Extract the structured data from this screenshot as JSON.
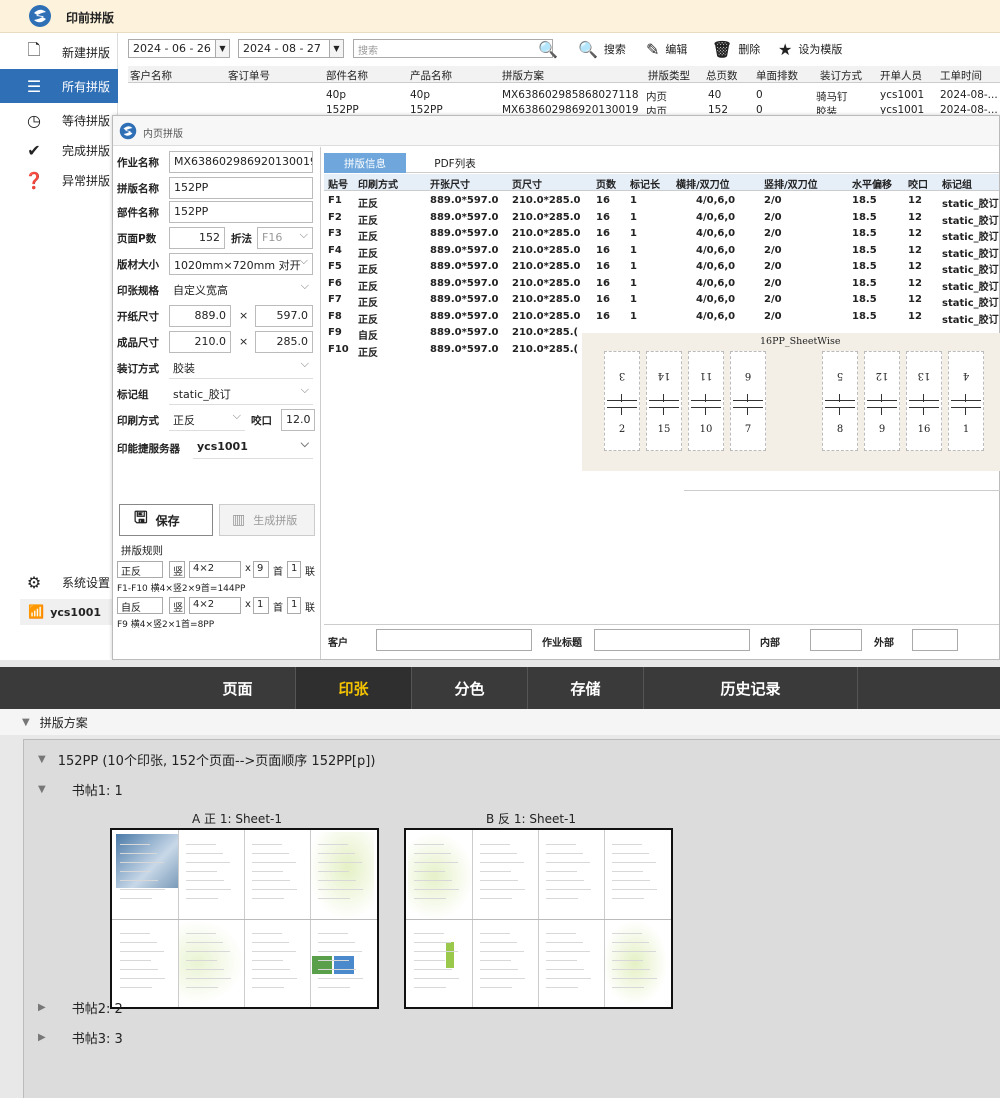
{
  "app": {
    "title": "印前拼版",
    "sidebar": [
      {
        "label": "新建拼版",
        "icon": "new-file-icon",
        "glyph": "🗋"
      },
      {
        "label": "所有拼版",
        "icon": "list-icon",
        "glyph": "☰"
      },
      {
        "label": "等待拼版",
        "icon": "clock-icon",
        "glyph": "◷"
      },
      {
        "label": "完成拼版",
        "icon": "check-icon",
        "glyph": "✔"
      },
      {
        "label": "异常拼版",
        "icon": "question-icon",
        "glyph": "❓"
      }
    ],
    "settings_label": "系统设置",
    "user": "ycs1001"
  },
  "toolbar": {
    "date_from": "2024 - 06 - 26",
    "date_to": "2024 - 08 - 27",
    "search_placeholder": "搜索",
    "search_label": "搜索",
    "edit_label": "编辑",
    "delete_label": "删除",
    "template_label": "设为模版"
  },
  "job_table": {
    "headers": [
      "客户名称",
      "客订单号",
      "部件名称",
      "产品名称",
      "拼版方案",
      "拼版类型",
      "总页数",
      "单面排数",
      "装订方式",
      "开单人员",
      "工单时间"
    ],
    "rows": [
      [
        "",
        "",
        "40p",
        "40p",
        "MX638602985868027118",
        "内页",
        "40",
        "0",
        "骑马钉",
        "ycs1001",
        "2024-08-..."
      ],
      [
        "",
        "",
        "152PP",
        "152PP",
        "MX638602986920130019",
        "内页",
        "152",
        "0",
        "胶装",
        "ycs1001",
        "2024-08-..."
      ]
    ]
  },
  "dialog": {
    "title": "内页拼版",
    "form": {
      "job_name_label": "作业名称",
      "job_name": "MX638602986920130019",
      "imp_name_label": "拼版名称",
      "imp_name": "152PP",
      "part_name_label": "部件名称",
      "part_name": "152PP",
      "pages_label": "页面P数",
      "pages": "152",
      "fold_label": "折法",
      "fold": "F16",
      "plate_label": "版材大小",
      "plate": "1020mm×720mm 对开",
      "paper_spec_label": "印张规格",
      "paper_spec": "自定义宽高",
      "open_size_label": "开纸尺寸",
      "open_w": "889.0",
      "open_h": "597.0",
      "final_size_label": "成品尺寸",
      "final_w": "210.0",
      "final_h": "285.0",
      "times": "×",
      "binding_label": "装订方式",
      "binding": "胶装",
      "mark_group_label": "标记组",
      "mark_group": "static_胶订",
      "print_mode_label": "印刷方式",
      "print_mode": "正反",
      "bite_label": "咬口",
      "bite": "12.0",
      "server_label": "印能捷服务器",
      "server": "ycs1001",
      "save_label": "保存",
      "generate_label": "生成拼版",
      "rules_label": "拼版规则",
      "rule1": {
        "mode": "正反",
        "orient": "竖",
        "grid": "4×2",
        "x": "x",
        "count": "9",
        "unit": "首",
        "joint": "1",
        "joint_unit": "联",
        "note": "F1-F10  横4×竖2×9首=144PP"
      },
      "rule2": {
        "mode": "自反",
        "orient": "竖",
        "grid": "4×2",
        "x": "x",
        "count": "1",
        "unit": "首",
        "joint": "1",
        "joint_unit": "联",
        "note": "F9  横4×竖2×1首=8PP"
      }
    },
    "tabs": [
      "拼版信息",
      "PDF列表"
    ],
    "sheet_headers": [
      "贴号",
      "印刷方式",
      "开张尺寸",
      "页尺寸",
      "页数",
      "标记长",
      "横排/双刀位",
      "竖排/双刀位",
      "水平偏移",
      "咬口",
      "标记组"
    ],
    "sheets": [
      [
        "F1",
        "正反",
        "889.0*597.0",
        "210.0*285.0",
        "16",
        "1",
        "4/0,6,0",
        "2/0",
        "18.5",
        "12",
        "static_胶订"
      ],
      [
        "F2",
        "正反",
        "889.0*597.0",
        "210.0*285.0",
        "16",
        "1",
        "4/0,6,0",
        "2/0",
        "18.5",
        "12",
        "static_胶订"
      ],
      [
        "F3",
        "正反",
        "889.0*597.0",
        "210.0*285.0",
        "16",
        "1",
        "4/0,6,0",
        "2/0",
        "18.5",
        "12",
        "static_胶订"
      ],
      [
        "F4",
        "正反",
        "889.0*597.0",
        "210.0*285.0",
        "16",
        "1",
        "4/0,6,0",
        "2/0",
        "18.5",
        "12",
        "static_胶订"
      ],
      [
        "F5",
        "正反",
        "889.0*597.0",
        "210.0*285.0",
        "16",
        "1",
        "4/0,6,0",
        "2/0",
        "18.5",
        "12",
        "static_胶订"
      ],
      [
        "F6",
        "正反",
        "889.0*597.0",
        "210.0*285.0",
        "16",
        "1",
        "4/0,6,0",
        "2/0",
        "18.5",
        "12",
        "static_胶订"
      ],
      [
        "F7",
        "正反",
        "889.0*597.0",
        "210.0*285.0",
        "16",
        "1",
        "4/0,6,0",
        "2/0",
        "18.5",
        "12",
        "static_胶订"
      ],
      [
        "F8",
        "正反",
        "889.0*597.0",
        "210.0*285.0",
        "16",
        "1",
        "4/0,6,0",
        "2/0",
        "18.5",
        "12",
        "static_胶订"
      ],
      [
        "F9",
        "自反",
        "889.0*597.0",
        "210.0*285.(",
        "",
        "",
        "",
        "",
        "",
        "",
        ""
      ],
      [
        "F10",
        "正反",
        "889.0*597.0",
        "210.0*285.(",
        "",
        "",
        "",
        "",
        "",
        "",
        ""
      ]
    ],
    "imposition_caption": "16PP_SheetWise",
    "imposition_pages": [
      {
        "top": "3",
        "bottom": "2"
      },
      {
        "top": "14",
        "bottom": "15"
      },
      {
        "top": "11",
        "bottom": "10"
      },
      {
        "top": "6",
        "bottom": "7"
      },
      {
        "top": "5",
        "bottom": "8"
      },
      {
        "top": "12",
        "bottom": "9"
      },
      {
        "top": "13",
        "bottom": "16"
      },
      {
        "top": "4",
        "bottom": "1"
      }
    ],
    "bottom_fields": {
      "customer": "客户",
      "job_title": "作业标题",
      "inner": "内部",
      "outer": "外部"
    }
  },
  "bottom_panel": {
    "nav": [
      "页面",
      "印张",
      "分色",
      "存储",
      "历史记录"
    ],
    "active_nav": 1,
    "scheme_label": "拼版方案",
    "root": "152PP (10个印张, 152个页面-->页面顺序 152PP[p])",
    "signature1": "书帖1:  1",
    "sheet_a": "A 正 1: Sheet-1",
    "sheet_b": "B 反 1: Sheet-1",
    "signature2": "书帖2:  2",
    "signature3": "书帖3:  3"
  },
  "colors": {
    "accent": "#2f6fb6",
    "tab_active": "#6fa7dc",
    "nav_active": "#f5c400"
  }
}
